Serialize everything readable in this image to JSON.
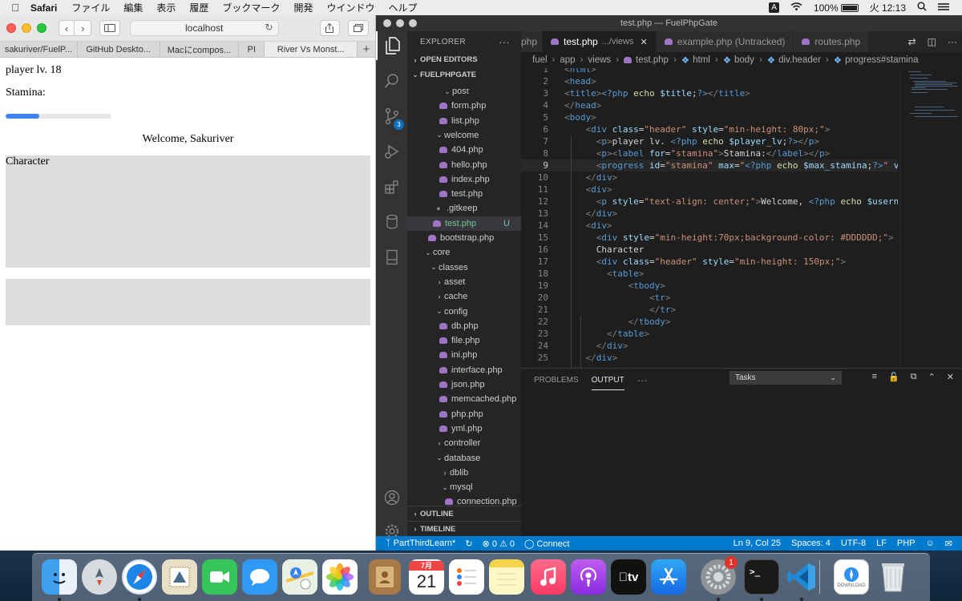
{
  "menubar": {
    "app": "Safari",
    "items": [
      "ファイル",
      "編集",
      "表示",
      "履歴",
      "ブックマーク",
      "開発",
      "ウインドウ",
      "ヘルプ"
    ],
    "ime": "A",
    "battery": "100%",
    "clock": "火 12:13"
  },
  "safari": {
    "url": "localhost",
    "tabs": [
      "sakuriver/FuelP...",
      "GitHub Deskto...",
      "Macにcompos...",
      "PI",
      "River Vs Monst..."
    ],
    "page": {
      "player_label": "player lv. 18",
      "stamina_label": "Stamina:",
      "stamina_fraction": 0.32,
      "welcome": "Welcome, Sakuriver",
      "character_label": "Character"
    }
  },
  "vscode": {
    "window_title": "test.php — FuelPhpGate",
    "explorer": {
      "title": "EXPLORER",
      "open_editors": "OPEN EDITORS",
      "root": "FUELPHPGATE",
      "rows": [
        {
          "label": "post",
          "kind": "folder-open",
          "indent": 44
        },
        {
          "label": "form.php",
          "kind": "php",
          "indent": 40
        },
        {
          "label": "list.php",
          "kind": "php",
          "indent": 40
        },
        {
          "label": "welcome",
          "kind": "folder-open",
          "indent": 34
        },
        {
          "label": "404.php",
          "kind": "php",
          "indent": 40
        },
        {
          "label": "hello.php",
          "kind": "php",
          "indent": 40
        },
        {
          "label": "index.php",
          "kind": "php",
          "indent": 40
        },
        {
          "label": "test.php",
          "kind": "php",
          "indent": 40
        },
        {
          "label": ".gitkeep",
          "kind": "file",
          "indent": 34
        },
        {
          "label": "test.php",
          "kind": "php",
          "indent": 32,
          "selected": true,
          "status": "U"
        },
        {
          "label": "bootstrap.php",
          "kind": "php",
          "indent": 26
        },
        {
          "label": "core",
          "kind": "folder-open",
          "indent": 20
        },
        {
          "label": "classes",
          "kind": "folder-open",
          "indent": 27
        },
        {
          "label": "asset",
          "kind": "folder",
          "indent": 34
        },
        {
          "label": "cache",
          "kind": "folder",
          "indent": 34
        },
        {
          "label": "config",
          "kind": "folder-open",
          "indent": 34
        },
        {
          "label": "db.php",
          "kind": "php",
          "indent": 40
        },
        {
          "label": "file.php",
          "kind": "php",
          "indent": 40
        },
        {
          "label": "ini.php",
          "kind": "php",
          "indent": 40
        },
        {
          "label": "interface.php",
          "kind": "php",
          "indent": 40
        },
        {
          "label": "json.php",
          "kind": "php",
          "indent": 40
        },
        {
          "label": "memcached.php",
          "kind": "php",
          "indent": 40
        },
        {
          "label": "php.php",
          "kind": "php",
          "indent": 40
        },
        {
          "label": "yml.php",
          "kind": "php",
          "indent": 40
        },
        {
          "label": "controller",
          "kind": "folder",
          "indent": 34
        },
        {
          "label": "database",
          "kind": "folder-open",
          "indent": 34
        },
        {
          "label": "dblib",
          "kind": "folder",
          "indent": 41
        },
        {
          "label": "mysql",
          "kind": "folder-open",
          "indent": 41
        },
        {
          "label": "connection.php",
          "kind": "php",
          "indent": 47
        }
      ],
      "outline": "OUTLINE",
      "timeline": "TIMELINE"
    },
    "tabs": [
      {
        "label": "php",
        "desc": "",
        "active": false
      },
      {
        "label": "test.php",
        "desc": ".../views",
        "active": true
      },
      {
        "label": "example.php (Untracked)",
        "desc": "",
        "active": false
      },
      {
        "label": "routes.php",
        "desc": "",
        "active": false
      }
    ],
    "breadcrumb": [
      "fuel",
      "app",
      "views",
      "test.php",
      "html",
      "body",
      "div.header",
      "progress#stamina"
    ],
    "code": [
      {
        "n": "1",
        "html": "<span style='color:#808080'>&lt;</span><span style='color:#569cd6'>html</span><span style='color:#808080'>&gt;</span>"
      },
      {
        "n": "2",
        "html": "<span style='color:#808080'>&lt;</span><span style='color:#569cd6'>head</span><span style='color:#808080'>&gt;</span>"
      },
      {
        "n": "3",
        "html": "<span style='color:#808080'>&lt;</span><span style='color:#569cd6'>title</span><span style='color:#808080'>&gt;</span><span style='color:#569cd6'>&lt;?php</span> <span style='color:#dcdcaa'>echo</span> <span style='color:#9cdcfe'>$title</span>;<span style='color:#569cd6'>?&gt;</span><span style='color:#808080'>&lt;/</span><span style='color:#569cd6'>title</span><span style='color:#808080'>&gt;</span>"
      },
      {
        "n": "4",
        "html": "<span style='color:#808080'>&lt;/</span><span style='color:#569cd6'>head</span><span style='color:#808080'>&gt;</span>"
      },
      {
        "n": "5",
        "html": "<span style='color:#808080'>&lt;</span><span style='color:#569cd6'>body</span><span style='color:#808080'>&gt;</span>"
      },
      {
        "n": "6",
        "html": "    <span style='color:#808080'>&lt;</span><span style='color:#569cd6'>div</span> <span style='color:#9cdcfe'>class</span>=<span style='color:#ce9178'>\"header\"</span> <span style='color:#9cdcfe'>style</span>=<span style='color:#ce9178'>\"min-height: 80px;\"</span><span style='color:#808080'>&gt;</span>"
      },
      {
        "n": "7",
        "html": "      <span style='color:#808080'>&lt;</span><span style='color:#569cd6'>p</span><span style='color:#808080'>&gt;</span>player lv. <span style='color:#569cd6'>&lt;?php</span> <span style='color:#dcdcaa'>echo</span> <span style='color:#9cdcfe'>$player_lv</span>;<span style='color:#569cd6'>?&gt;</span><span style='color:#808080'>&lt;/</span><span style='color:#569cd6'>p</span><span style='color:#808080'>&gt;</span>"
      },
      {
        "n": "8",
        "html": "      <span style='color:#808080'>&lt;</span><span style='color:#569cd6'>p</span><span style='color:#808080'>&gt;&lt;</span><span style='color:#569cd6'>label</span> <span style='color:#9cdcfe'>for</span>=<span style='color:#ce9178'>\"stamina\"</span><span style='color:#808080'>&gt;</span>Stamina:<span style='color:#808080'>&lt;/</span><span style='color:#569cd6'>label</span><span style='color:#808080'>&gt;&lt;/</span><span style='color:#569cd6'>p</span><span style='color:#808080'>&gt;</span>"
      },
      {
        "n": "9",
        "html": "      <span style='color:#808080'>&lt;</span><span style='color:#569cd6'>progress</span> <span style='color:#9cdcfe'>id</span>=<span style='color:#ce9178'>\"stamina\"</span> <span style='color:#9cdcfe'>max</span>=<span style='color:#ce9178'>\"</span><span style='color:#569cd6'>&lt;?php</span> <span style='color:#dcdcaa'>echo</span> <span style='color:#9cdcfe'>$max_stamina</span>;<span style='color:#569cd6'>?&gt;</span><span style='color:#ce9178'>\"</span> <span style='color:#9cdcfe'>value</span>=<span style='color:#ce9178'>\"</span>"
      },
      {
        "n": "10",
        "html": "    <span style='color:#808080'>&lt;/</span><span style='color:#569cd6'>div</span><span style='color:#808080'>&gt;</span>"
      },
      {
        "n": "11",
        "html": "    <span style='color:#808080'>&lt;</span><span style='color:#569cd6'>div</span><span style='color:#808080'>&gt;</span>"
      },
      {
        "n": "12",
        "html": "      <span style='color:#808080'>&lt;</span><span style='color:#569cd6'>p</span> <span style='color:#9cdcfe'>style</span>=<span style='color:#ce9178'>\"text-align: center;\"</span><span style='color:#808080'>&gt;</span>Welcome, <span style='color:#569cd6'>&lt;?php</span> <span style='color:#dcdcaa'>echo</span> <span style='color:#9cdcfe'>$username</span><span style='color:#569cd6'>?&gt;</span><span style='color:#808080'>&lt;/</span>"
      },
      {
        "n": "13",
        "html": "    <span style='color:#808080'>&lt;/</span><span style='color:#569cd6'>div</span><span style='color:#808080'>&gt;</span>"
      },
      {
        "n": "14",
        "html": "    <span style='color:#808080'>&lt;</span><span style='color:#569cd6'>div</span><span style='color:#808080'>&gt;</span>"
      },
      {
        "n": "15",
        "html": "      <span style='color:#808080'>&lt;</span><span style='color:#569cd6'>div</span> <span style='color:#9cdcfe'>style</span>=<span style='color:#ce9178'>\"min-height:70px;background-color: #DDDDDD;\"</span><span style='color:#808080'>&gt;</span>"
      },
      {
        "n": "16",
        "html": "      Character"
      },
      {
        "n": "17",
        "html": "      <span style='color:#808080'>&lt;</span><span style='color:#569cd6'>div</span> <span style='color:#9cdcfe'>class</span>=<span style='color:#ce9178'>\"header\"</span> <span style='color:#9cdcfe'>style</span>=<span style='color:#ce9178'>\"min-height: 150px;\"</span><span style='color:#808080'>&gt;</span>"
      },
      {
        "n": "18",
        "html": "        <span style='color:#808080'>&lt;</span><span style='color:#569cd6'>table</span><span style='color:#808080'>&gt;</span>"
      },
      {
        "n": "19",
        "html": "            <span style='color:#808080'>&lt;</span><span style='color:#569cd6'>tbody</span><span style='color:#808080'>&gt;</span>"
      },
      {
        "n": "20",
        "html": "                <span style='color:#808080'>&lt;</span><span style='color:#569cd6'>tr</span><span style='color:#808080'>&gt;</span>"
      },
      {
        "n": "21",
        "html": "                <span style='color:#808080'>&lt;/</span><span style='color:#569cd6'>tr</span><span style='color:#808080'>&gt;</span>"
      },
      {
        "n": "22",
        "html": "            <span style='color:#808080'>&lt;/</span><span style='color:#569cd6'>tbody</span><span style='color:#808080'>&gt;</span>"
      },
      {
        "n": "23",
        "html": "        <span style='color:#808080'>&lt;/</span><span style='color:#569cd6'>table</span><span style='color:#808080'>&gt;</span>"
      },
      {
        "n": "24",
        "html": "      <span style='color:#808080'>&lt;/</span><span style='color:#569cd6'>div</span><span style='color:#808080'>&gt;</span>"
      },
      {
        "n": "25",
        "html": "    <span style='color:#808080'>&lt;/</span><span style='color:#569cd6'>div</span><span style='color:#808080'>&gt;</span>"
      }
    ],
    "current_line": "9",
    "panel": {
      "tabs": [
        "PROBLEMS",
        "OUTPUT"
      ],
      "task": "Tasks"
    },
    "status": {
      "branch": "PartThirdLearn*",
      "problems": "⊗ 0 ⚠ 0",
      "connect": "Connect",
      "position": "Ln 9, Col 25",
      "spaces": "Spaces: 4",
      "encoding": "UTF-8",
      "eol": "LF",
      "language": "PHP"
    }
  },
  "dock": {
    "calendar_month": "7月",
    "calendar_day": "21",
    "appstore_badge": "1",
    "preview_caption": "DOWNLOAD",
    "tv_label": "tv"
  },
  "colors": {
    "accent": "#007acc",
    "progress": "#3b82f6",
    "panel_gray": "#dddddd"
  }
}
